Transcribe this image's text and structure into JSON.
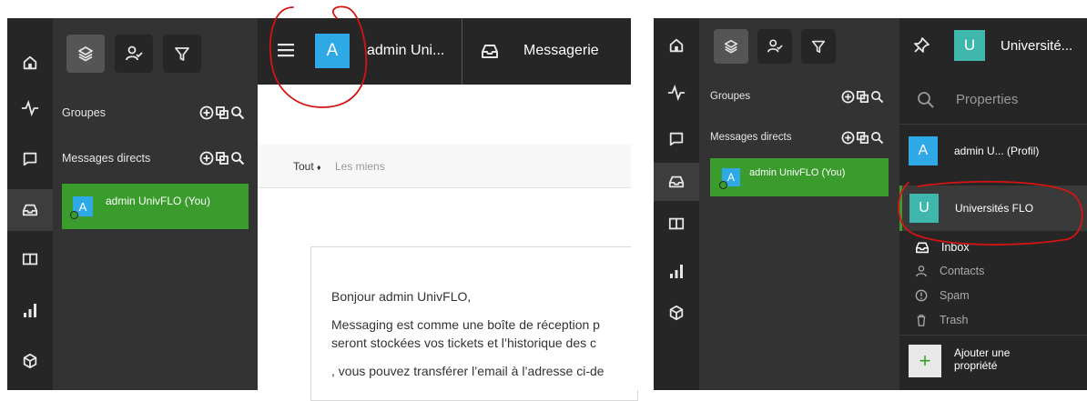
{
  "left": {
    "header": {
      "avatar_letter": "A",
      "user_name": "admin Uni...",
      "inbox_title": "Messagerie"
    },
    "sidebar": {
      "groups_label": "Groupes",
      "direct_label": "Messages directs",
      "direct_item": "admin UnivFLO (You)",
      "direct_item_avatar": "A"
    },
    "main": {
      "filter_all": "Tout",
      "filter_sort_glyph": "♦",
      "filter_mine": "Les miens",
      "greeting": "Bonjour admin UnivFLO,",
      "body_line1": "Messaging est comme une boîte de réception p",
      "body_line2": "seront stockées vos tickets et l’historique des c",
      "body_line3": ", vous pouvez transférer l’email à l’adresse ci-de"
    }
  },
  "right": {
    "sidebar": {
      "groups_label": "Groupes",
      "direct_label": "Messages directs",
      "direct_item": "admin UnivFLO (You)",
      "direct_item_avatar": "A"
    },
    "properties": {
      "header_letter": "U",
      "header_name": "Université...",
      "search_placeholder": "Properties",
      "profile_letter": "A",
      "profile_name": "admin U... (Profil)",
      "org_letter": "U",
      "org_name": "Universités FLO",
      "sub_items": [
        "Inbox",
        "Contacts",
        "Spam",
        "Trash"
      ],
      "add_label_line1": "Ajouter une",
      "add_label_line2": "propriété",
      "add_symbol": "+"
    }
  },
  "colors": {
    "rail": "#262626",
    "panel": "#333333",
    "active_green": "#3a9c2c",
    "avatar_blue": "#2fa8e6",
    "avatar_teal": "#3fb7ad",
    "annotation_red": "#d41414"
  }
}
